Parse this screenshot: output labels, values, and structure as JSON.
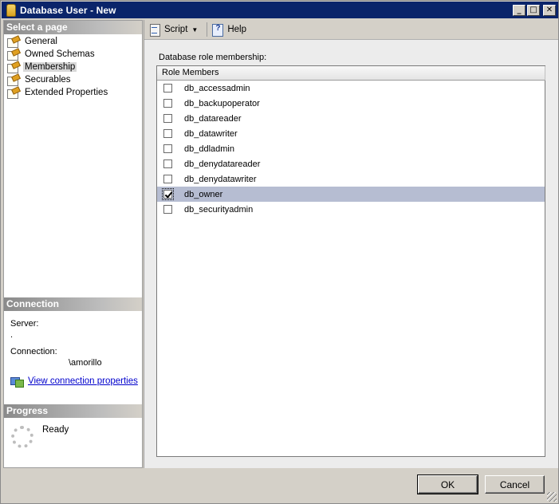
{
  "window": {
    "title": "Database User - New",
    "minimize_glyph": "_",
    "maximize_glyph": "□",
    "close_glyph": "✕"
  },
  "left_pane": {
    "select_page_header": "Select a page",
    "pages": [
      {
        "label": "General",
        "selected": false
      },
      {
        "label": "Owned Schemas",
        "selected": false
      },
      {
        "label": "Membership",
        "selected": true
      },
      {
        "label": "Securables",
        "selected": false
      },
      {
        "label": "Extended Properties",
        "selected": false
      }
    ],
    "connection_header": "Connection",
    "server_label": "Server:",
    "server_value": ".",
    "connection_label": "Connection:",
    "connection_value": "\\amorillo",
    "view_connection_link": "View connection properties",
    "progress_header": "Progress",
    "progress_status": "Ready"
  },
  "toolbar": {
    "script_label": "Script",
    "dropdown_glyph": "▼",
    "help_label": "Help"
  },
  "membership": {
    "section_label": "Database role membership:",
    "column_header": "Role Members",
    "roles": [
      {
        "name": "db_accessadmin",
        "checked": false
      },
      {
        "name": "db_backupoperator",
        "checked": false
      },
      {
        "name": "db_datareader",
        "checked": false
      },
      {
        "name": "db_datawriter",
        "checked": false
      },
      {
        "name": "db_ddladmin",
        "checked": false
      },
      {
        "name": "db_denydatareader",
        "checked": false
      },
      {
        "name": "db_denydatawriter",
        "checked": false
      },
      {
        "name": "db_owner",
        "checked": true
      },
      {
        "name": "db_securityadmin",
        "checked": false
      }
    ],
    "selected_row": 7
  },
  "buttons": {
    "ok_label": "OK",
    "cancel_label": "Cancel"
  }
}
